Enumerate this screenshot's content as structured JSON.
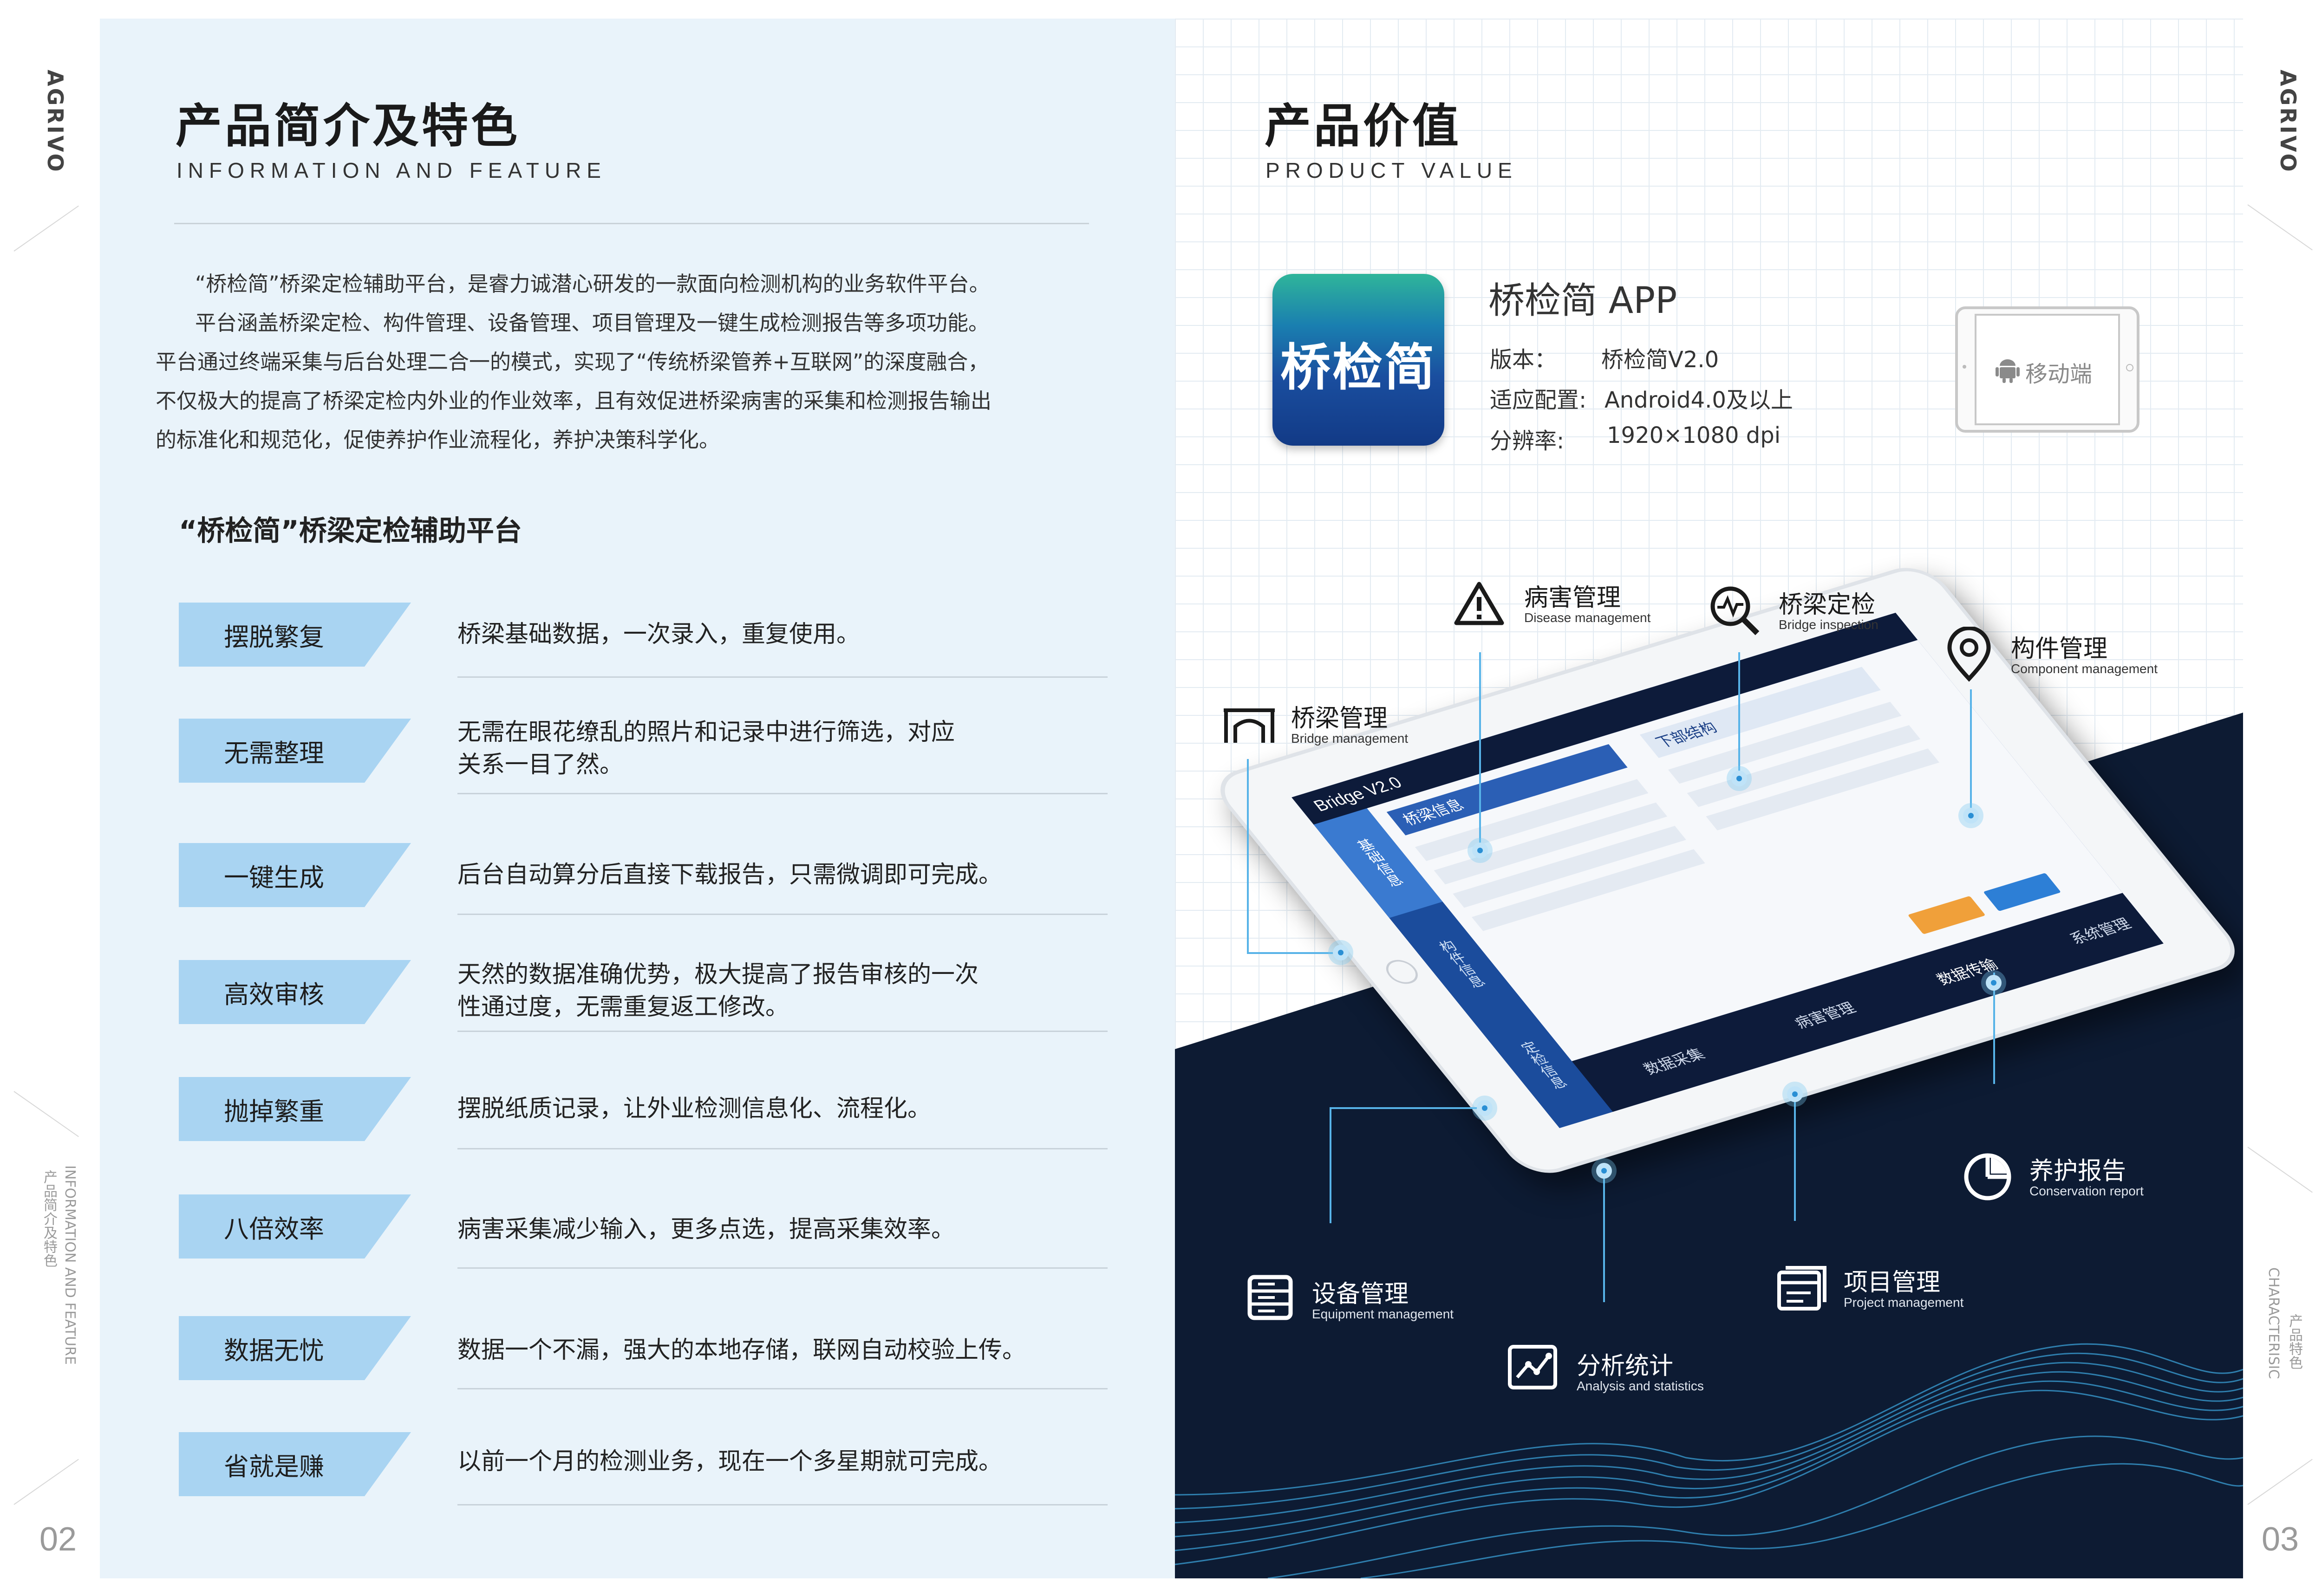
{
  "brand": {
    "logo": "AGRIVO"
  },
  "left": {
    "title": "产品简介及特色",
    "subtitle": "INFORMATION AND FEATURE",
    "intro": [
      "“桥检简”桥梁定检辅助平台，是睿力诚潜心研发的一款面向检测机构的业务软件平台。",
      "平台涵盖桥梁定检、构件管理、设备管理、项目管理及一键生成检测报告等多项功能。",
      "平台通过终端采集与后台处理二合一的模式，实现了“传统桥梁管养+互联网”的深度融合，",
      "不仅极大的提高了桥梁定检内外业的作业效率，且有效促进桥梁病害的采集和检测报告输出",
      "的标准化和规范化，促使养护作业流程化，养护决策科学化。"
    ],
    "platform_title": "“桥检简”桥梁定检辅助平台",
    "features": [
      {
        "label": "摆脱繁复",
        "desc": "桥梁基础数据，一次录入，重复使用。"
      },
      {
        "label": "无需整理",
        "desc": "无需在眼花缭乱的照片和记录中进行筛选，对应\n关系一目了然。"
      },
      {
        "label": "一键生成",
        "desc": "后台自动算分后直接下载报告，只需微调即可完成。"
      },
      {
        "label": "高效审核",
        "desc": "天然的数据准确优势，极大提高了报告审核的一次\n性通过度，无需重复返工修改。"
      },
      {
        "label": "抛掉繁重",
        "desc": "摆脱纸质记录，让外业检测信息化、流程化。"
      },
      {
        "label": "八倍效率",
        "desc": "病害采集减少输入，更多点选，提高采集效率。"
      },
      {
        "label": "数据无忧",
        "desc": "数据一个不漏，强大的本地存储，联网自动校验上传。"
      },
      {
        "label": "省就是赚",
        "desc": "以前一个月的检测业务，现在一个多星期就可完成。"
      }
    ],
    "page_number": "02",
    "side_label_cn": "产品简介及特色",
    "side_label_en": "INFORMATION AND FEATURE"
  },
  "right": {
    "title": "产品价值",
    "subtitle": "PRODUCT VALUE",
    "app": {
      "icon_text": "桥检简",
      "name": "桥检简 APP",
      "version_label": "版本：",
      "version_value": "桥检简V2.0",
      "config_label": "适应配置:",
      "config_value": "Android4.0及以上",
      "resolution_label": "分辨率:",
      "resolution_value": "1920×1080 dpi"
    },
    "mobile_badge": "移动端",
    "modules": [
      {
        "title": "桥梁管理",
        "sub": "Bridge management",
        "icon": "bridge-icon"
      },
      {
        "title": "病害管理",
        "sub": "Disease management",
        "icon": "warning-icon"
      },
      {
        "title": "桥梁定检",
        "sub": "Bridge inspection",
        "icon": "inspection-icon"
      },
      {
        "title": "构件管理",
        "sub": "Component management",
        "icon": "location-pin-icon"
      },
      {
        "title": "养护报告",
        "sub": "Conservation report",
        "icon": "pie-chart-icon"
      },
      {
        "title": "设备管理",
        "sub": "Equipment management",
        "icon": "equipment-icon"
      },
      {
        "title": "项目管理",
        "sub": "Project management",
        "icon": "project-icon"
      },
      {
        "title": "分析统计",
        "sub": "Analysis and statistics",
        "icon": "analysis-icon"
      }
    ],
    "tablet_ui": {
      "app_title": "Bridge V2.0",
      "nav": [
        "基础信息",
        "构件信息",
        "定检信息"
      ],
      "tabs": [
        "数据采集",
        "病害管理",
        "数据传输",
        "系统管理"
      ],
      "panel_title": "桥梁信息",
      "panel2_title": "下部结构"
    },
    "page_number": "03",
    "side_label_cn": "产品特色",
    "side_label_en": "CHARACTERISIC"
  },
  "colors": {
    "left_bg": "#e9f3fa",
    "label_bg": "#a9d4f2",
    "navy": "#0d1b33",
    "accent": "#57b3e8"
  }
}
